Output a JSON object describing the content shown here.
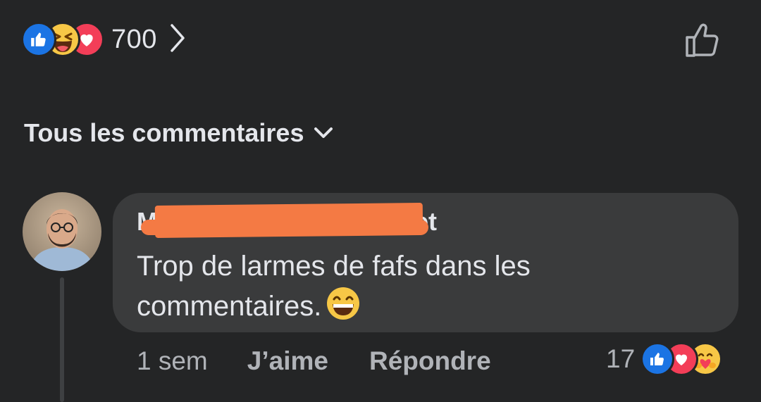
{
  "post": {
    "reactions": {
      "types": [
        "like",
        "haha",
        "love"
      ],
      "total": "700"
    }
  },
  "comments_filter": {
    "label": "Tous les commentaires"
  },
  "comment": {
    "author_visible_start": "M",
    "author_visible_end": "et",
    "text": "Trop de larmes de fafs dans les commentaires.",
    "emoji": "grinning-face",
    "time": "1 sem",
    "like_label": "J’aime",
    "reply_label": "Répondre",
    "reactions": {
      "types": [
        "like",
        "love",
        "care"
      ],
      "count": "17"
    }
  },
  "colors": {
    "background": "#242526",
    "bubble": "#3a3b3c",
    "text": "#e4e6eb",
    "secondary_text": "#b0b3b8",
    "like_blue": "#1b74e4",
    "love_red": "#f33e58",
    "haha_yellow": "#f7c746",
    "redaction": "#f47a44"
  }
}
